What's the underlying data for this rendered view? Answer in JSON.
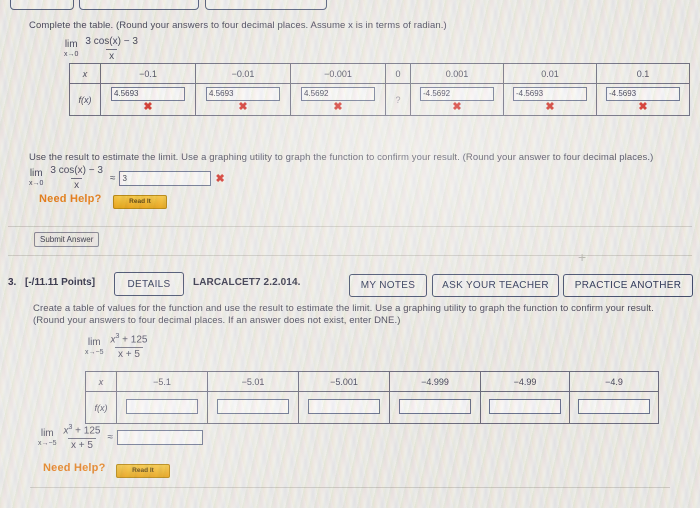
{
  "problem2": {
    "prompt": "Complete the table. (Round your answers to four decimal places. Assume x is in terms of radian.)",
    "limit": {
      "lim": "lim",
      "approach": "x→0",
      "numerator": "3 cos(x) − 3",
      "denominator": "x"
    },
    "table": {
      "row_label_x": "x",
      "row_label_fx": "f(x)",
      "x_values": [
        "−0.1",
        "−0.01",
        "−0.001",
        "0",
        "0.001",
        "0.01",
        "0.1"
      ],
      "fx_values": [
        "4.5693",
        "4.5693",
        "4.5692",
        "?",
        "-4.5692",
        "-4.5693",
        "-4.5693"
      ],
      "fx_marks": [
        "wrong",
        "wrong",
        "wrong",
        "none",
        "wrong",
        "wrong",
        "wrong"
      ],
      "wrong_mark": "✖"
    },
    "estimate_prompt": "Use the result to estimate the limit. Use a graphing utility to graph the function to confirm your result. (Round your answer to four decimal places.)",
    "estimate_value": "3",
    "estimate_mark": "✖",
    "approx_symbol": "≈",
    "need_help_label": "Need Help?",
    "read_it_label": "Read It",
    "submit_label": "Submit Answer"
  },
  "problem3": {
    "number": "3.",
    "points": "[-/11.11 Points]",
    "details_label": "DETAILS",
    "code": "LARCALCET7 2.2.014.",
    "my_notes_label": "MY NOTES",
    "ask_teacher_label": "ASK YOUR TEACHER",
    "practice_another_label": "PRACTICE ANOTHER",
    "prompt_line1": "Create a table of values for the function and use the result to estimate the limit. Use a graphing utility to graph the function to confirm your result.",
    "prompt_line2": "(Round your answers to four decimal places. If an answer does not exist, enter DNE.)",
    "limit": {
      "lim": "lim",
      "approach": "x→−5",
      "numerator_base": "x",
      "numerator_exp": "3",
      "numerator_rest": " + 125",
      "denominator": "x + 5"
    },
    "table": {
      "row_label_x": "x",
      "row_label_fx": "f(x)",
      "x_values": [
        "−5.1",
        "−5.01",
        "−5.001",
        "−4.999",
        "−4.99",
        "−4.9"
      ],
      "fx_values": [
        "",
        "",
        "",
        "",
        "",
        ""
      ]
    },
    "answer_value": "",
    "approx_symbol": "≈",
    "need_help_label": "Need Help?",
    "read_it_label": "Read It"
  },
  "colors": {
    "accent_orange": "#e8821e",
    "button_gold": "#e8a413",
    "wrong_red": "#d4332b",
    "outline_blue": "#46506e",
    "page_bg": "#efeee9"
  }
}
